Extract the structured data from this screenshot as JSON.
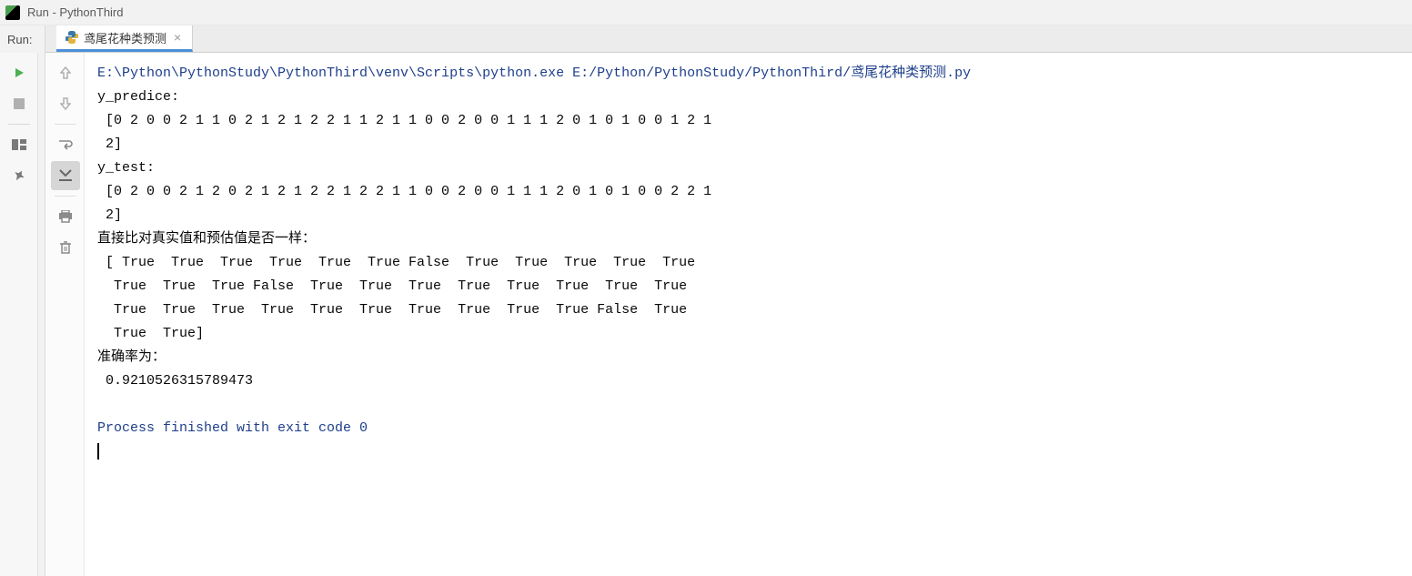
{
  "window": {
    "title": "Run - PythonThird"
  },
  "run_panel": {
    "label": "Run:"
  },
  "tab": {
    "label": "鸢尾花种类预测"
  },
  "console": {
    "command": "E:\\Python\\PythonStudy\\PythonThird\\venv\\Scripts\\python.exe E:/Python/PythonStudy/PythonThird/鸢尾花种类预测.py",
    "lines": [
      "y_predice:",
      " [0 2 0 0 2 1 1 0 2 1 2 1 2 2 1 1 2 1 1 0 0 2 0 0 1 1 1 2 0 1 0 1 0 0 1 2 1",
      " 2]",
      "y_test:",
      " [0 2 0 0 2 1 2 0 2 1 2 1 2 2 1 2 2 1 1 0 0 2 0 0 1 1 1 2 0 1 0 1 0 0 2 2 1",
      " 2]",
      "直接比对真实值和预估值是否一样：",
      " [ True  True  True  True  True  True False  True  True  True  True  True",
      "  True  True  True False  True  True  True  True  True  True  True  True",
      "  True  True  True  True  True  True  True  True  True  True False  True",
      "  True  True]",
      "准确率为：",
      " 0.9210526315789473",
      ""
    ],
    "exit_message": "Process finished with exit code 0"
  }
}
